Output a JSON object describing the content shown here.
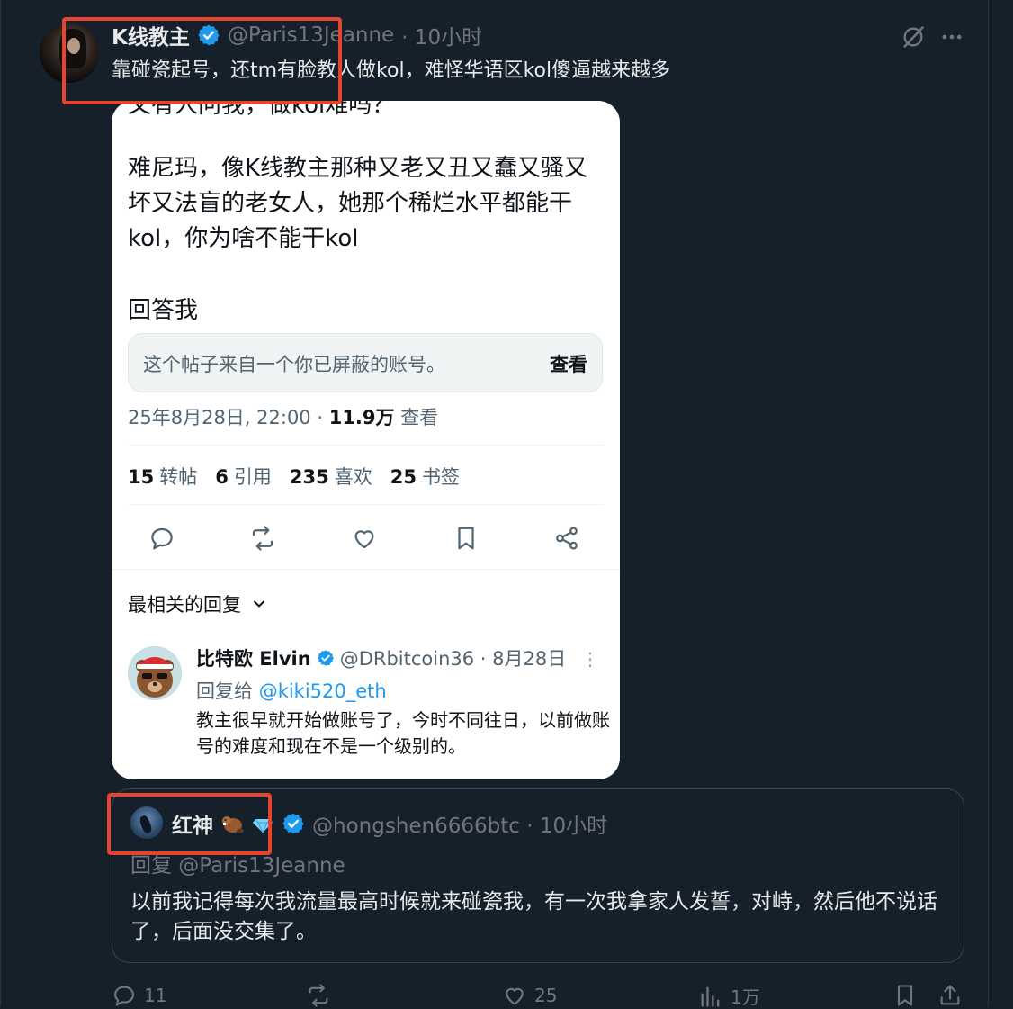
{
  "post": {
    "author_name": "K线教主",
    "handle": "@Paris13Jeanne",
    "time": "· 10小时",
    "text": "靠碰瓷起号，还tm有脸教人做kol，难怪华语区kol傻逼越来越多"
  },
  "top_icons": [
    "grok-icon",
    "more-icon"
  ],
  "embedded": {
    "cut_top_text": "又有人问我，做kol难吗？",
    "body": "难尼玛，像K线教主那种又老又丑又蠢又骚又坏又法盲的老女人，她那个稀烂水平都能干kol，你为啥不能干kol",
    "answer": "回答我",
    "blocked_notice": "这个帖子来自一个你已屏蔽的账号。",
    "blocked_view": "查看",
    "meta_date": "25年8月28日, 22:00 · ",
    "meta_views": "11.9万",
    "meta_views_label": " 查看",
    "stats": [
      {
        "num": "15",
        "label": "转帖"
      },
      {
        "num": "6",
        "label": "引用"
      },
      {
        "num": "235",
        "label": "喜欢"
      },
      {
        "num": "25",
        "label": "书签"
      }
    ],
    "replies_header": "最相关的回复",
    "reply": {
      "name": "比特欧 Elvin",
      "handle": "@DRbitcoin36 · 8月28日",
      "reply_to_label": "回复给 ",
      "reply_to_handle": "@kiki520_eth",
      "text": "教主很早就开始做账号了，今时不同往日，以前做账号的难度和现在不是一个级别的。"
    }
  },
  "quote": {
    "name": "红神",
    "handle": "@hongshen6666btc · 10小时",
    "reply_to": "回复 @Paris13Jeanne",
    "text": "以前我记得每次我流量最高时候就来碰瓷我，有一次我拿家人发誓，对峙，然后他不说话了，后面没交集了。"
  },
  "actions": {
    "replies": "11",
    "reposts": "",
    "likes": "25",
    "views": "1万"
  },
  "colors": {
    "background": "#15202b",
    "verified": "#1d9bf0",
    "highlight_box": "#e5452e"
  }
}
